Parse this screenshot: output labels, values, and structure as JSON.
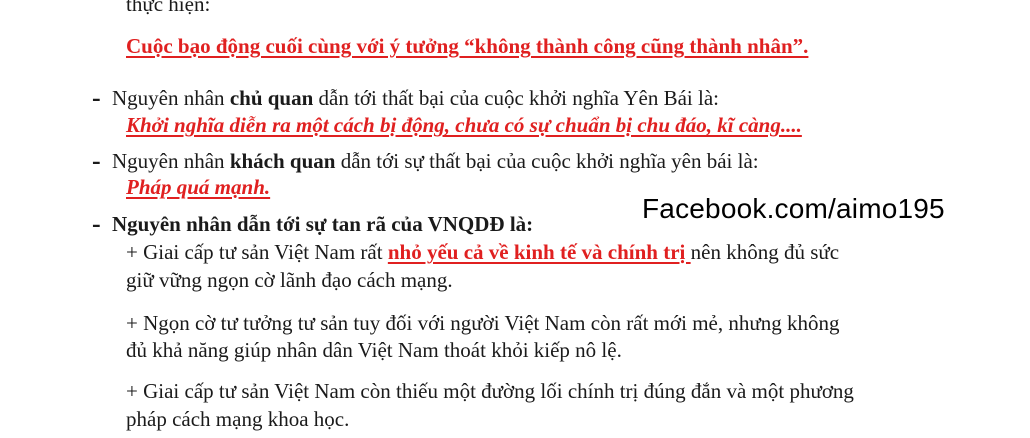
{
  "top_partial": "thực hiện:",
  "answer1": "Cuộc bạo động cuối cùng với ý tưởng “không thành công cũng thành nhân”.",
  "dash": "-",
  "subjective": {
    "prefix": "Nguyên nhân ",
    "bold": "chủ quan",
    "suffix": " dẫn tới thất bại của cuộc khởi nghĩa Yên Bái là:",
    "answer": "Khởi nghĩa diễn ra một cách bị động, chưa có sự chuẩn bị chu đáo, kĩ càng...."
  },
  "objective": {
    "prefix": "Nguyên nhân ",
    "bold": "khách quan",
    "suffix": " dẫn tới sự thất bại của cuộc khởi nghĩa yên bái là:",
    "answer": "Pháp quá mạnh."
  },
  "dissolution": {
    "heading": "Nguyên nhân dẫn tới sự tan rã của VNQDĐ là:",
    "p1_a": "+ Giai cấp tư sản Việt Nam rất ",
    "p1_red": "nhỏ yếu cả về kinh tế và chính trị ",
    "p1_b": "nên không đủ sức",
    "p1_c": "giữ vững ngọn cờ lãnh đạo cách mạng.",
    "p2_a": "+ Ngọn cờ tư tưởng tư sản tuy đối với người Việt Nam còn rất mới mẻ, nhưng không",
    "p2_b": "đủ khả năng giúp nhân dân Việt Nam thoát khỏi kiếp nô lệ.",
    "p3_a": "+ Giai cấp tư sản Việt Nam còn thiếu một đường lối chính trị đúng đắn và một phương",
    "p3_b": "pháp cách mạng khoa học."
  },
  "watermark": "Facebook.com/aimo195"
}
